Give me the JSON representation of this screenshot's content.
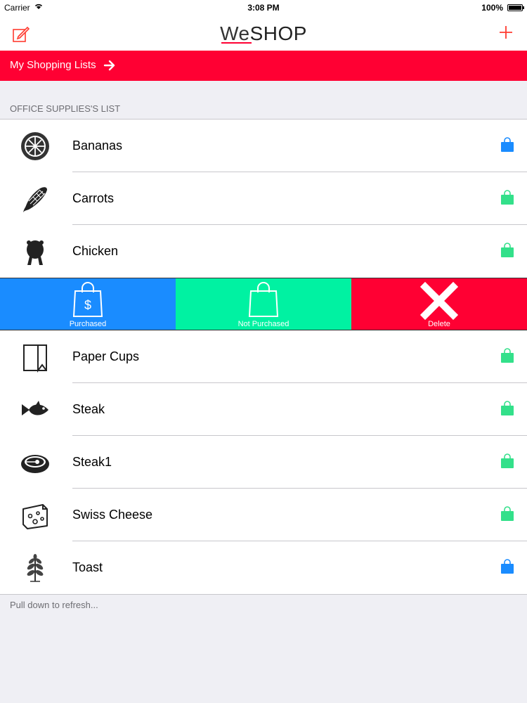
{
  "status_bar": {
    "carrier": "Carrier",
    "time": "3:08 PM",
    "battery": "100%"
  },
  "nav": {
    "title_we": "We",
    "title_shop": "SHOP",
    "compose_icon": "compose-icon",
    "add_icon": "plus-icon"
  },
  "banner": {
    "label": "My Shopping Lists",
    "icon": "arrow-right-icon"
  },
  "section": {
    "title": "OFFICE SUPPLIES'S LIST"
  },
  "items": [
    {
      "name": "Bananas",
      "icon": "orange-slice-icon",
      "status": "purchased"
    },
    {
      "name": "Carrots",
      "icon": "corn-icon",
      "status": "not-purchased"
    },
    {
      "name": "Chicken",
      "icon": "chicken-icon",
      "status": "not-purchased"
    },
    {
      "name": "Paper Cups",
      "icon": "paper-bag-icon",
      "status": "not-purchased"
    },
    {
      "name": "Steak",
      "icon": "fish-icon",
      "status": "not-purchased"
    },
    {
      "name": "Steak1",
      "icon": "steak-icon",
      "status": "not-purchased"
    },
    {
      "name": "Swiss Cheese",
      "icon": "cheese-icon",
      "status": "not-purchased"
    },
    {
      "name": "Toast",
      "icon": "herb-icon",
      "status": "purchased"
    }
  ],
  "swipe_actions": {
    "purchased": "Purchased",
    "not_purchased": "Not Purchased",
    "delete": "Delete"
  },
  "colors": {
    "accent": "#ff0033",
    "purchased": "#1a8cff",
    "not_purchased": "#00f2a2",
    "bag_blue": "#1a8cff",
    "bag_green": "#33e08a"
  },
  "footer": {
    "pull_text": "Pull down to refresh..."
  }
}
